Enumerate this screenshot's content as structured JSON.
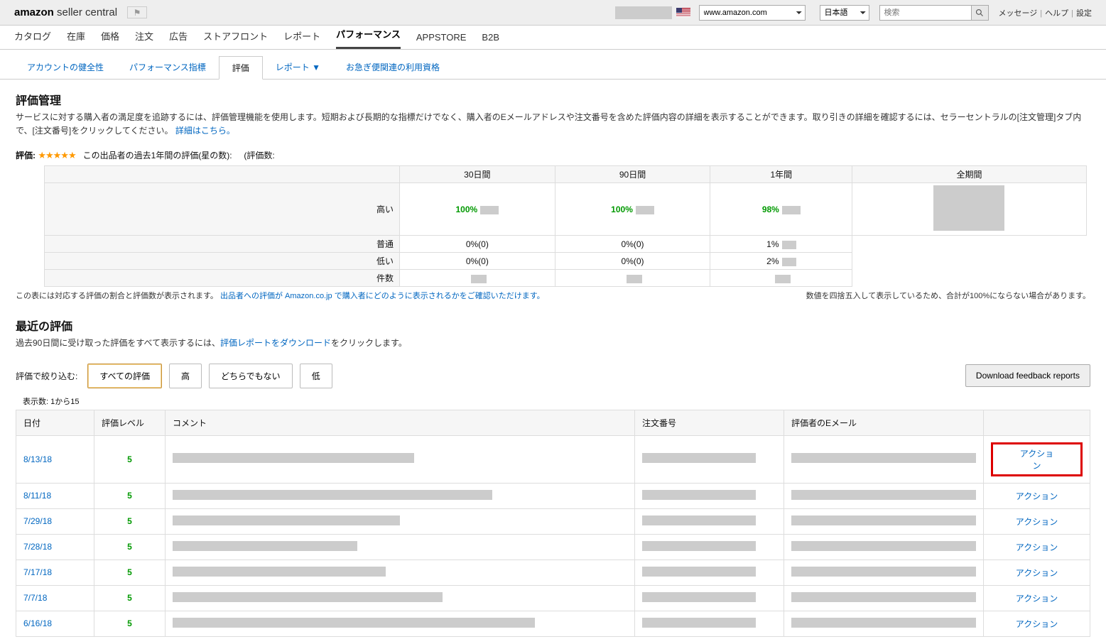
{
  "header": {
    "logo_bold": "amazon",
    "logo_rest": " seller central",
    "marketplace": "www.amazon.com",
    "lang": "日本語",
    "search_placeholder": "検索",
    "links": {
      "msg": "メッセージ",
      "help": "ヘルプ",
      "settings": "設定"
    }
  },
  "main_nav": [
    "カタログ",
    "在庫",
    "価格",
    "注文",
    "広告",
    "ストアフロント",
    "レポート",
    "パフォーマンス",
    "APPSTORE",
    "B2B"
  ],
  "main_nav_active": 7,
  "sub_nav": [
    "アカウントの健全性",
    "パフォーマンス指標",
    "評価",
    "レポート ▼",
    "お急ぎ便関連の利用資格"
  ],
  "sub_nav_active": 2,
  "page": {
    "title": "評価管理",
    "desc": "サービスに対する購入者の満足度を追跡するには、評価管理機能を使用します。短期および長期的な指標だけでなく、購入者のEメールアドレスや注文番号を含めた評価内容の詳細を表示することができます。取り引きの詳細を確認するには、セラーセントラルの[注文管理]タブ内で、[注文番号]をクリックしてください。",
    "more": "詳細はこちら。"
  },
  "rating": {
    "label": "評価:",
    "caption": "この出品者の過去1年間の評価(星の数):",
    "count_label": "(評価数:"
  },
  "summary": {
    "cols": [
      "30日間",
      "90日間",
      "1年間",
      "全期間"
    ],
    "rows": [
      {
        "label": "高い",
        "v": [
          "100%",
          "100%",
          "98%",
          ""
        ]
      },
      {
        "label": "普通",
        "v": [
          "0%(0)",
          "0%(0)",
          "1%",
          ""
        ]
      },
      {
        "label": "低い",
        "v": [
          "0%(0)",
          "0%(0)",
          "2%",
          ""
        ]
      },
      {
        "label": "件数",
        "v": [
          "",
          "",
          "",
          ""
        ]
      }
    ]
  },
  "foot_left_a": "この表には対応する評価の割合と評価数が表示されます。",
  "foot_link1": "出品者への評価が",
  "foot_link2": "Amazon.co.jp",
  "foot_left_b": "で購入者にどのように表示されるかをご確認いただけます。",
  "foot_right": "数値を四捨五入して表示しているため、合計が100%にならない場合があります。",
  "recent": {
    "title": "最近の評価",
    "desc_a": "過去90日間に受け取った評価をすべて表示するには、",
    "desc_link": "評価レポートをダウンロード",
    "desc_b": "をクリックします。"
  },
  "filter": {
    "label": "評価で絞り込む:",
    "buttons": [
      "すべての評価",
      "高",
      "どちらでもない",
      "低"
    ],
    "download": "Download feedback reports",
    "count": "表示数:  1から15"
  },
  "table": {
    "headers": [
      "日付",
      "評価レベル",
      "コメント",
      "注文番号",
      "評価者のEメール",
      ""
    ],
    "action": "アクション",
    "rows": [
      {
        "date": "8/13/18",
        "level": "5",
        "cw": 340,
        "highlight": true
      },
      {
        "date": "8/11/18",
        "level": "5",
        "cw": 450
      },
      {
        "date": "7/29/18",
        "level": "5",
        "cw": 320
      },
      {
        "date": "7/28/18",
        "level": "5",
        "cw": 260
      },
      {
        "date": "7/17/18",
        "level": "5",
        "cw": 300
      },
      {
        "date": "7/7/18",
        "level": "5",
        "cw": 380
      },
      {
        "date": "6/16/18",
        "level": "5",
        "cw": 510
      }
    ]
  }
}
